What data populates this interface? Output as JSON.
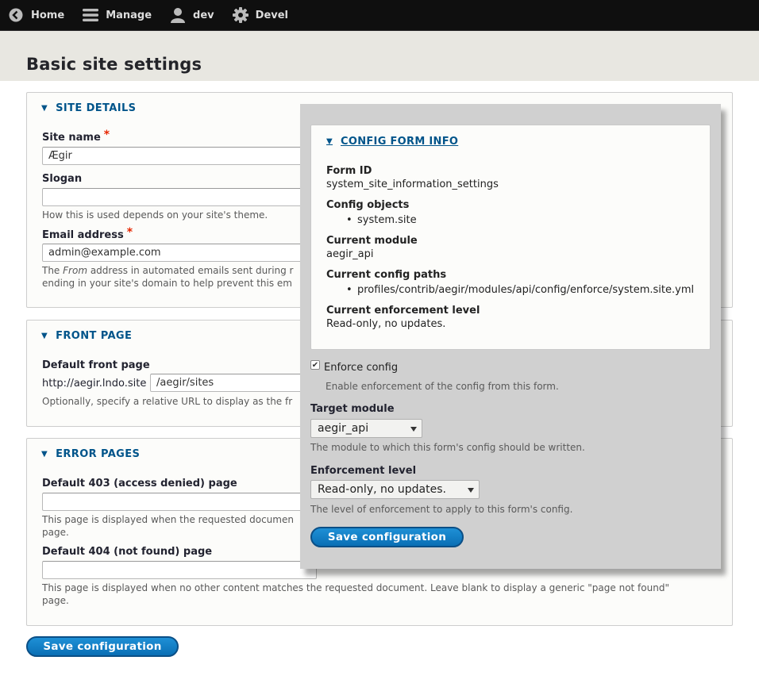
{
  "toolbar": {
    "items": [
      {
        "label": "Home",
        "icon": "back-circle-icon"
      },
      {
        "label": "Manage",
        "icon": "hamburger-menu-icon"
      },
      {
        "label": "dev",
        "icon": "user-icon"
      },
      {
        "label": "Devel",
        "icon": "gear-icon"
      }
    ]
  },
  "page": {
    "title": "Basic site settings"
  },
  "site_details": {
    "summary": "Site details",
    "site_name": {
      "label": "Site name",
      "value": "Ægir"
    },
    "slogan": {
      "label": "Slogan",
      "value": "",
      "description": "How this is used depends on your site's theme."
    },
    "email": {
      "label": "Email address",
      "value": "admin@example.com",
      "desc_prefix": "The ",
      "desc_italic": "From",
      "desc_line1_rest": " address in automated emails sent during r",
      "desc_line2": "ending in your site's domain to help prevent this em"
    }
  },
  "front_page": {
    "summary": "Front page",
    "label": "Default front page",
    "prefix": "http://aegir.lndo.site",
    "value": "/aegir/sites",
    "description": "Optionally, specify a relative URL to display as the fr"
  },
  "error_pages": {
    "summary": "Error pages",
    "p403": {
      "label": "Default 403 (access denied) page",
      "value": "",
      "desc_line1": "This page is displayed when the requested documen",
      "desc_line2": "page."
    },
    "p404": {
      "label": "Default 404 (not found) page",
      "value": "",
      "desc_line1": "This page is displayed when no other content matches the requested document. Leave blank to display a generic \"page not found\"",
      "desc_line2": "page."
    }
  },
  "save_button": "Save configuration",
  "overlay": {
    "summary": "Config form info",
    "form_id_label": "Form ID",
    "form_id": "system_site_information_settings",
    "config_objects_label": "Config objects",
    "config_objects": [
      "system.site"
    ],
    "current_module_label": "Current module",
    "current_module": "aegir_api",
    "config_paths_label": "Current config paths",
    "config_paths": [
      "profiles/contrib/aegir/modules/api/config/enforce/system.site.yml"
    ],
    "enforcement_level_label": "Current enforcement level",
    "enforcement_level": "Read-only, no updates.",
    "enforce_checkbox": {
      "label": "Enforce config",
      "checked": true,
      "description": "Enable enforcement of the config from this form."
    },
    "target_module": {
      "label": "Target module",
      "selected": "aegir_api",
      "description": "The module to which this form's config should be written."
    },
    "enforcement_select": {
      "label": "Enforcement level",
      "selected": "Read-only, no updates.",
      "description": "The level of enforcement to apply to this form's config."
    },
    "save_button": "Save configuration"
  },
  "colors": {
    "toolbar_bg": "#0f0f0f",
    "link_blue": "#00548a",
    "button_blue": "#0a6fb5",
    "required_red": "#e62600",
    "header_bg": "#e8e7e1",
    "overlay_bg": "#d0d0d0"
  }
}
